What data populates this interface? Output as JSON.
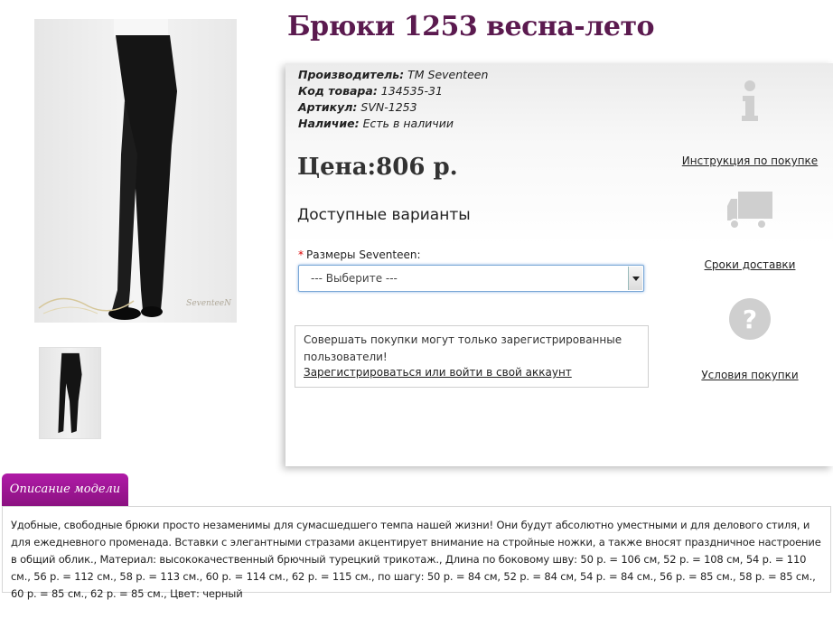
{
  "product": {
    "title": "Брюки 1253 весна-лето",
    "manufacturer_label": "Производитель:",
    "manufacturer_value": "TM Seventeen",
    "code_label": "Код товара:",
    "code_value": "134535-31",
    "article_label": "Артикул:",
    "article_value": "SVN-1253",
    "availability_label": "Наличие:",
    "availability_value": "Есть в наличии",
    "price": "Цена:806 р."
  },
  "photo": {
    "watermark": "SeventeeN"
  },
  "options": {
    "title": "Доступные варианты",
    "required_mark": "*",
    "size_label": "Размеры Seventeen:",
    "size_selected": "--- Выберите ---"
  },
  "notice": {
    "text": "Совершать покупки могут только зарегистрированные пользователи!",
    "link": "Зарегистрироваться или войти в свой аккаунт"
  },
  "side_links": {
    "instruction": "Инструкция по покупке",
    "delivery": "Сроки доставки",
    "conditions": "Условия покупки"
  },
  "description": {
    "tab_label": "Описание модели",
    "text": "Удобные, свободные брюки просто незаменимы для сумасшедшего темпа нашей жизни! Они будут абсолютно уместными и для делового стиля, и для ежедневного променада. Вставки с элегантными стразами акцентирует внимание на стройные ножки, а также вносят праздничное настроение в общий облик., Материал: высококачественный брючный турецкий трикотаж., Длина по боковому шву: 50 р. = 106 см, 52 р. = 108 см, 54 р. = 110 см., 56 р. = 112 см., 58 р. = 113 см., 60 р. = 114 см., 62 р. = 115 см., по шагу: 50 р. = 84 см, 52 р. = 84 см, 54 р. = 84 см., 56 р. = 85 см., 58 р. = 85 см., 60 р. = 85 см., 62 р. = 85 см., Цвет: черный"
  },
  "colors": {
    "title": "#5b1a4f",
    "tab": "#9b1690",
    "icon_gray": "#cfcfcf"
  },
  "icons": [
    "info-icon",
    "truck-icon",
    "question-icon"
  ]
}
